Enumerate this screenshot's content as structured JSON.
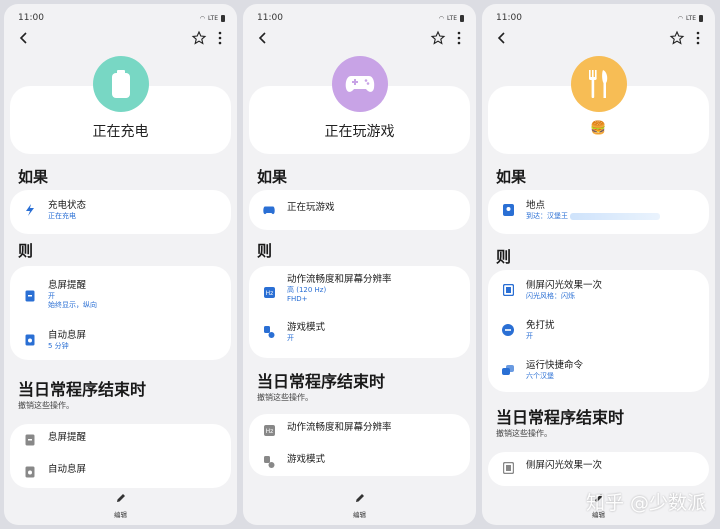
{
  "status": {
    "time": "11:00",
    "network": "LTE"
  },
  "panels": [
    {
      "hero_title": "正在充电",
      "hero_color": "#78d7c4",
      "hero_icon": "battery-icon",
      "if_heading": "如果",
      "if_items": [
        {
          "title": "充电状态",
          "detail": "正在充电",
          "icon": "lightning-icon"
        }
      ],
      "then_heading": "则",
      "then_items": [
        {
          "title": "息屏提醒",
          "detail": "开",
          "detail2": "始终显示，纵向",
          "icon": "aod-icon"
        },
        {
          "title": "自动息屏",
          "detail": "5 分钟",
          "icon": "screen-timeout-icon"
        }
      ],
      "end_heading": "当日常程序结束时",
      "end_sub": "撤销这些操作。",
      "end_items": [
        {
          "title": "息屏提醒"
        },
        {
          "title": "自动息屏"
        }
      ],
      "edit_label": "编辑"
    },
    {
      "hero_title": "正在玩游戏",
      "hero_color": "#c8a3e6",
      "hero_icon": "gamepad-icon",
      "if_heading": "如果",
      "if_items": [
        {
          "title": "正在玩游戏",
          "icon": "gamepad-icon"
        }
      ],
      "then_heading": "则",
      "then_items": [
        {
          "title": "动作流畅度和屏幕分辨率",
          "detail": "高 (120 Hz)",
          "detail2": "FHD+",
          "icon": "hz-icon"
        },
        {
          "title": "游戏模式",
          "detail": "开",
          "icon": "game-mode-icon"
        }
      ],
      "end_heading": "当日常程序结束时",
      "end_sub": "撤销这些操作。",
      "end_items": [
        {
          "title": "动作流畅度和屏幕分辨率"
        },
        {
          "title": "游戏模式"
        }
      ],
      "edit_label": "编辑"
    },
    {
      "hero_title": "🍔",
      "hero_color": "#f7bd55",
      "hero_icon": "fork-knife-icon",
      "if_heading": "如果",
      "if_items": [
        {
          "title": "地点",
          "detail": "到达：汉堡王",
          "icon": "location-icon"
        }
      ],
      "then_heading": "则",
      "then_items": [
        {
          "title": "侧屏闪光效果一次",
          "detail": "闪光风格：闪烁",
          "icon": "edge-lighting-icon"
        },
        {
          "title": "免打扰",
          "detail": "开",
          "icon": "dnd-icon"
        },
        {
          "title": "运行快捷命令",
          "detail": "六个汉堡",
          "icon": "shortcut-icon"
        }
      ],
      "end_heading": "当日常程序结束时",
      "end_sub": "撤销这些操作。",
      "end_items": [
        {
          "title": "侧屏闪光效果一次"
        }
      ],
      "edit_label": "编辑"
    }
  ],
  "watermark": "知乎 @少数派",
  "colors": {
    "accent_blue": "#2a6fd4",
    "card_bg": "#ffffff",
    "page_bg": "#f2f2f4"
  }
}
